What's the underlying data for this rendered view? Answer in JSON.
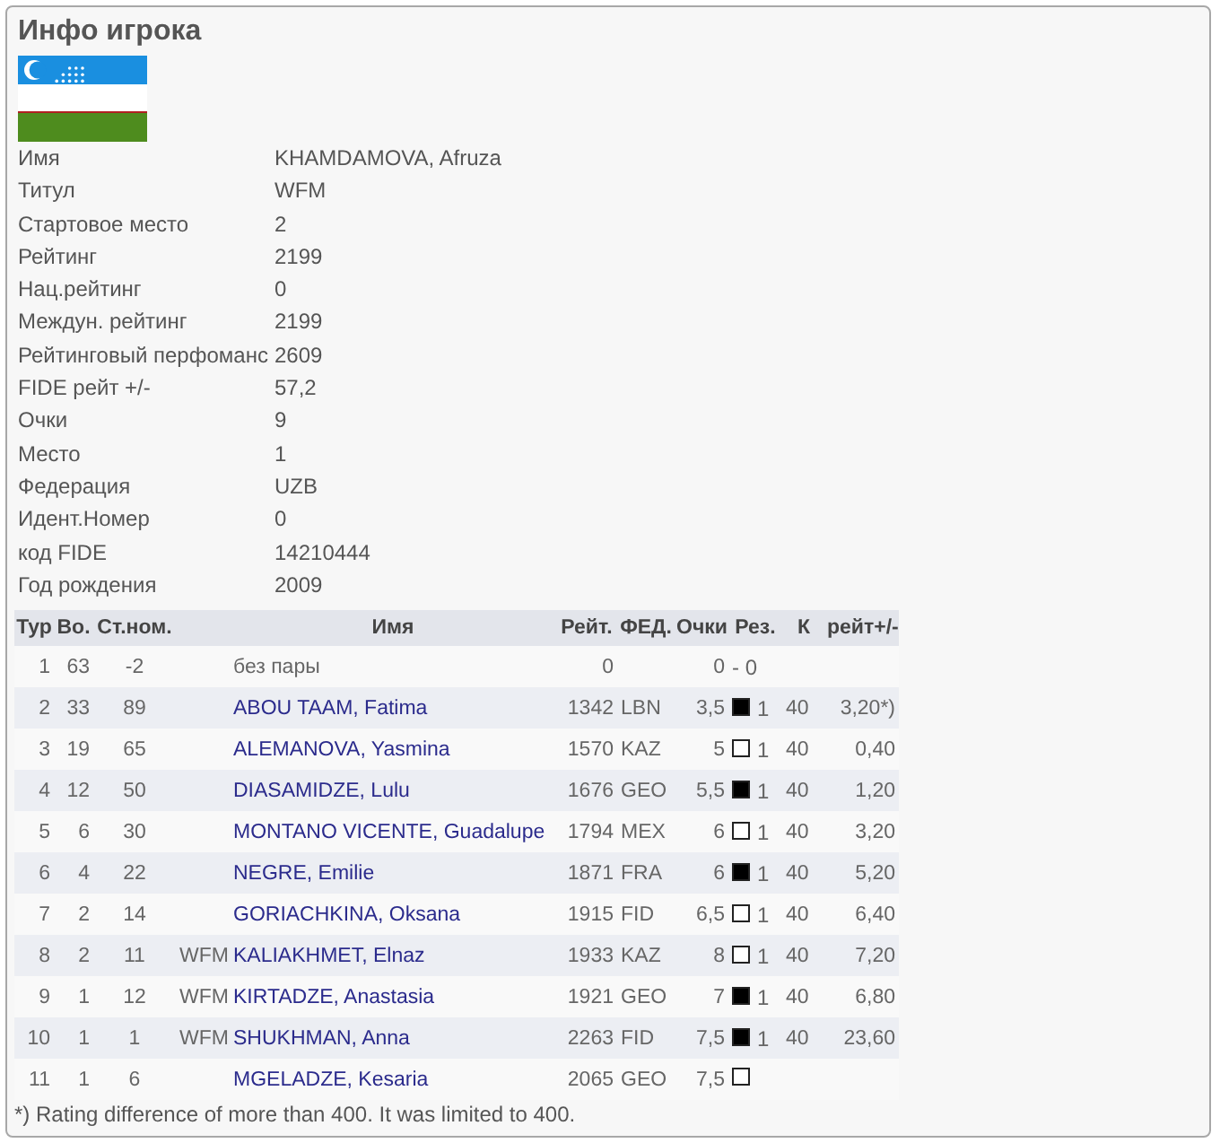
{
  "title": "Инфо игрока",
  "info": [
    {
      "label": "Имя",
      "value": "KHAMDAMOVA, Afruza"
    },
    {
      "label": "Титул",
      "value": "WFM"
    },
    {
      "label": "Стартовое место",
      "value": "2"
    },
    {
      "label": "Рейтинг",
      "value": "2199"
    },
    {
      "label": "Нац.рейтинг",
      "value": "0"
    },
    {
      "label": "Междун. рейтинг",
      "value": "2199"
    },
    {
      "label": "Рейтинговый перфоманс",
      "value": "2609"
    },
    {
      "label": "FIDE рейт +/-",
      "value": "57,2"
    },
    {
      "label": "Очки",
      "value": "9"
    },
    {
      "label": "Место",
      "value": "1"
    },
    {
      "label": "Федерация",
      "value": "UZB"
    },
    {
      "label": "Идент.Номер",
      "value": "0"
    },
    {
      "label": "код FIDE",
      "value": "14210444"
    },
    {
      "label": "Год рождения",
      "value": "2009"
    }
  ],
  "table": {
    "columns": [
      "Тур",
      "Во.",
      "Ст.ном.",
      "",
      "Имя",
      "Рейт.",
      "ФЕД.",
      "Очки",
      "Рез.",
      "К",
      "рейт+/-"
    ],
    "rows": [
      {
        "kind": "bye",
        "round": "1",
        "board": "63",
        "start_no": "-2",
        "name": "без пары",
        "rating": "0",
        "points": "0",
        "result": "- 0"
      },
      {
        "kind": "player",
        "round": "2",
        "board": "33",
        "start_no": "89",
        "name": "ABOU TAAM, Fatima",
        "rating": "1342",
        "fed": "LBN",
        "points": "3,5",
        "black": true,
        "result": "1",
        "k": "40",
        "rating_change": "3,20*)"
      },
      {
        "kind": "player",
        "round": "3",
        "board": "19",
        "start_no": "65",
        "name": "ALEMANOVA, Yasmina",
        "rating": "1570",
        "fed": "KAZ",
        "points": "5",
        "black": false,
        "result": "1",
        "k": "40",
        "rating_change": "0,40"
      },
      {
        "kind": "player",
        "round": "4",
        "board": "12",
        "start_no": "50",
        "name": "DIASAMIDZE, Lulu",
        "rating": "1676",
        "fed": "GEO",
        "points": "5,5",
        "black": true,
        "result": "1",
        "k": "40",
        "rating_change": "1,20"
      },
      {
        "kind": "player",
        "round": "5",
        "board": "6",
        "start_no": "30",
        "name": "MONTANO VICENTE, Guadalupe",
        "rating": "1794",
        "fed": "MEX",
        "points": "6",
        "black": false,
        "result": "1",
        "k": "40",
        "rating_change": "3,20"
      },
      {
        "kind": "player",
        "round": "6",
        "board": "4",
        "start_no": "22",
        "name": "NEGRE, Emilie",
        "rating": "1871",
        "fed": "FRA",
        "points": "6",
        "black": true,
        "result": "1",
        "k": "40",
        "rating_change": "5,20"
      },
      {
        "kind": "player",
        "round": "7",
        "board": "2",
        "start_no": "14",
        "name": "GORIACHKINA, Oksana",
        "rating": "1915",
        "fed": "FID",
        "points": "6,5",
        "black": false,
        "result": "1",
        "k": "40",
        "rating_change": "6,40"
      },
      {
        "kind": "player",
        "round": "8",
        "board": "2",
        "start_no": "11",
        "title": "WFM",
        "name": "KALIAKHMET, Elnaz",
        "rating": "1933",
        "fed": "KAZ",
        "points": "8",
        "black": false,
        "result": "1",
        "k": "40",
        "rating_change": "7,20"
      },
      {
        "kind": "player",
        "round": "9",
        "board": "1",
        "start_no": "12",
        "title": "WFM",
        "name": "KIRTADZE, Anastasia",
        "rating": "1921",
        "fed": "GEO",
        "points": "7",
        "black": true,
        "result": "1",
        "k": "40",
        "rating_change": "6,80"
      },
      {
        "kind": "player",
        "round": "10",
        "board": "1",
        "start_no": "1",
        "title": "WFM",
        "name": "SHUKHMAN, Anna",
        "rating": "2263",
        "fed": "FID",
        "points": "7,5",
        "black": true,
        "result": "1",
        "k": "40",
        "rating_change": "23,60"
      },
      {
        "kind": "player",
        "round": "11",
        "board": "1",
        "start_no": "6",
        "name": "MGELADZE, Kesaria",
        "rating": "2065",
        "fed": "GEO",
        "points": "7,5",
        "black": false
      }
    ]
  },
  "footnote": "*) Rating difference of more than 400. It was limited to 400."
}
